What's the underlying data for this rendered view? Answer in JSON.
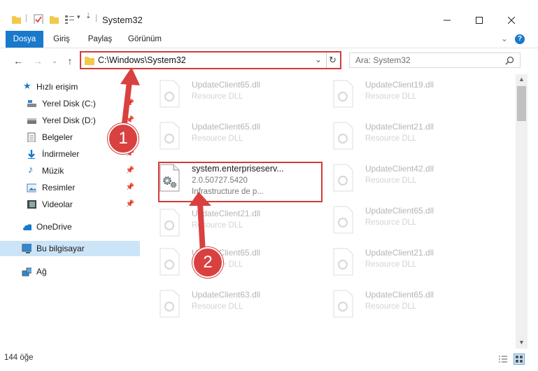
{
  "window": {
    "title": "System32"
  },
  "ribbon": {
    "tabs": [
      "Dosya",
      "Giriş",
      "Paylaş",
      "Görünüm"
    ]
  },
  "address": {
    "path": "C:\\Windows\\System32"
  },
  "search": {
    "placeholder": "Ara: System32"
  },
  "sidebar": {
    "items": [
      {
        "label": "Hızlı erişim",
        "icon": "star-icon",
        "pinned": false
      },
      {
        "label": "Yerel Disk (C:)",
        "icon": "drive-icon",
        "pinned": true
      },
      {
        "label": "Yerel Disk (D:)",
        "icon": "drive-icon",
        "pinned": true
      },
      {
        "label": "Belgeler",
        "icon": "documents-icon",
        "pinned": true
      },
      {
        "label": "İndirmeler",
        "icon": "download-icon",
        "pinned": true
      },
      {
        "label": "Müzik",
        "icon": "music-icon",
        "pinned": true
      },
      {
        "label": "Resimler",
        "icon": "pictures-icon",
        "pinned": true
      },
      {
        "label": "Videolar",
        "icon": "video-icon",
        "pinned": true
      },
      {
        "label": "OneDrive",
        "icon": "cloud-icon",
        "pinned": false
      },
      {
        "label": "Bu bilgisayar",
        "icon": "computer-icon",
        "pinned": false,
        "selected": true
      },
      {
        "label": "Ağ",
        "icon": "network-icon",
        "pinned": false
      }
    ]
  },
  "files": {
    "left": [
      {
        "name": "UpdateClient65.dll",
        "desc": "Resource DLL"
      },
      {
        "name": "UpdateClient65.dll",
        "desc": "Resource DLL"
      },
      {
        "name": "system.enterpriseserv...",
        "version": "2.0.50727.5420",
        "desc": "Infrastructure de p..."
      },
      {
        "name": "UpdateClient21.dll",
        "desc": "Resource DLL"
      },
      {
        "name": "UpdateClient65.dll",
        "desc": "Resource DLL"
      },
      {
        "name": "UpdateClient63.dll",
        "desc": "Resource DLL"
      }
    ],
    "right": [
      {
        "name": "UpdateClient19.dll",
        "desc": "Resource DLL"
      },
      {
        "name": "UpdateClient21.dll",
        "desc": "Resource DLL"
      },
      {
        "name": "UpdateClient42.dll",
        "desc": "Resource DLL"
      },
      {
        "name": "UpdateClient65.dll",
        "desc": "Resource DLL"
      },
      {
        "name": "UpdateClient21.dll",
        "desc": "Resource DLL"
      },
      {
        "name": "UpdateClient65.dll",
        "desc": "Resource DLL"
      }
    ]
  },
  "status": {
    "count": "144 öğe"
  },
  "annotations": {
    "step1": "1",
    "step2": "2"
  },
  "colors": {
    "accent": "#1979ca",
    "highlight": "#d33a3a",
    "selected": "#cce4f7"
  }
}
